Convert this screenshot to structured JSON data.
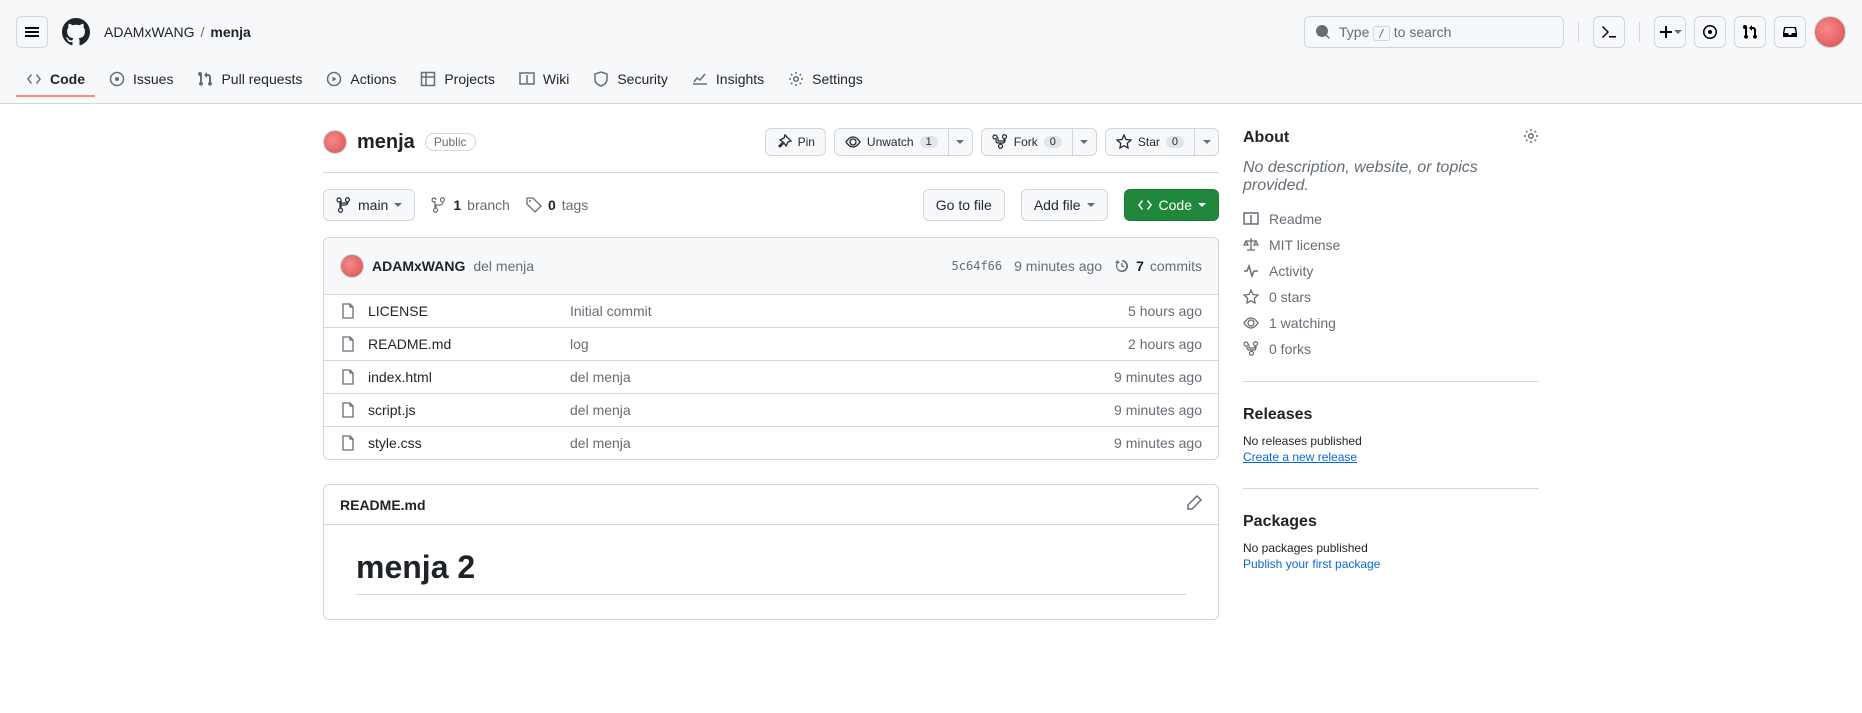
{
  "breadcrumb": {
    "owner": "ADAMxWANG",
    "repo": "menja"
  },
  "search": {
    "prefix": "Type ",
    "key": "/",
    "suffix": " to search"
  },
  "nav": {
    "code": "Code",
    "issues": "Issues",
    "pulls": "Pull requests",
    "actions": "Actions",
    "projects": "Projects",
    "wiki": "Wiki",
    "security": "Security",
    "insights": "Insights",
    "settings": "Settings"
  },
  "repo": {
    "name": "menja",
    "visibility": "Public"
  },
  "actions": {
    "pin": "Pin",
    "unwatch": "Unwatch",
    "watch_count": "1",
    "fork": "Fork",
    "fork_count": "0",
    "star": "Star",
    "star_count": "0"
  },
  "toolbar": {
    "branch": "main",
    "branches_count": "1",
    "branches_label": "branch",
    "tags_count": "0",
    "tags_label": "tags",
    "goto": "Go to file",
    "add": "Add file",
    "code": "Code"
  },
  "commit": {
    "author": "ADAMxWANG",
    "message": "del menja",
    "sha": "5c64f66",
    "time": "9 minutes ago",
    "count": "7",
    "count_label": "commits"
  },
  "files": [
    {
      "name": "LICENSE",
      "msg": "Initial commit",
      "time": "5 hours ago"
    },
    {
      "name": "README.md",
      "msg": "log",
      "time": "2 hours ago"
    },
    {
      "name": "index.html",
      "msg": "del menja",
      "time": "9 minutes ago"
    },
    {
      "name": "script.js",
      "msg": "del menja",
      "time": "9 minutes ago"
    },
    {
      "name": "style.css",
      "msg": "del menja",
      "time": "9 minutes ago"
    }
  ],
  "readme": {
    "filename": "README.md",
    "heading": "menja 2"
  },
  "about": {
    "title": "About",
    "desc": "No description, website, or topics provided.",
    "readme": "Readme",
    "license": "MIT license",
    "activity": "Activity",
    "stars": "0 stars",
    "watching": "1 watching",
    "forks": "0 forks"
  },
  "releases": {
    "title": "Releases",
    "none": "No releases published",
    "create": "Create a new release"
  },
  "packages": {
    "title": "Packages",
    "none": "No packages published",
    "publish": "Publish your first package"
  }
}
